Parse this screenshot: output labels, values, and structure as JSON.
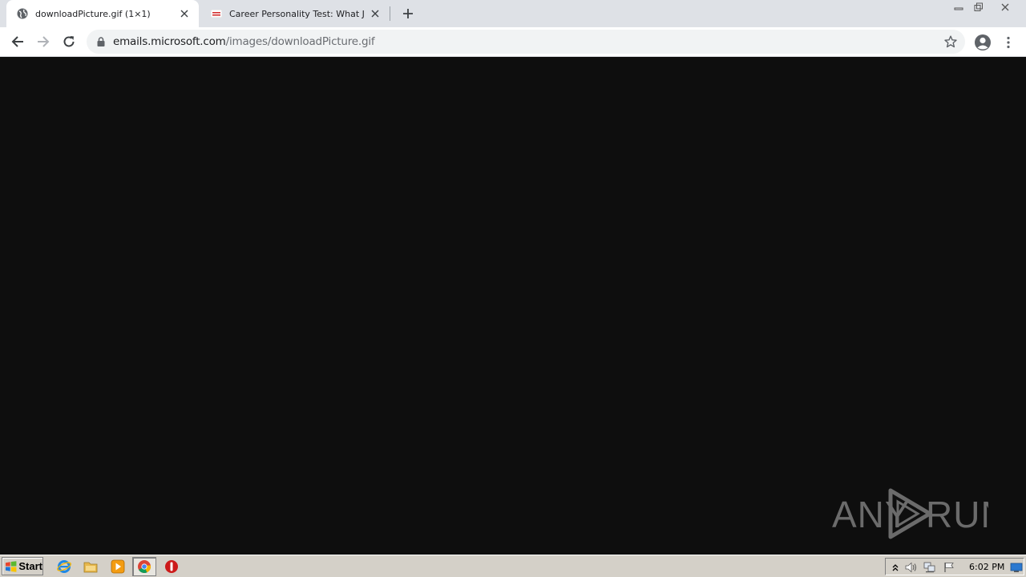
{
  "tabs": [
    {
      "title": "downloadPicture.gif (1×1)",
      "favicon": "globe-icon",
      "active": true
    },
    {
      "title": "Career Personality Test: What Job S",
      "favicon": "site-favicon-icon",
      "active": false
    }
  ],
  "toolbar": {
    "url_host": "emails.microsoft.com",
    "url_path": "/images/downloadPicture.gif"
  },
  "watermark": {
    "text_left": "ANY",
    "text_right": "RUN"
  },
  "taskbar": {
    "start_label": "Start",
    "clock": "6:02 PM",
    "pinned": [
      "internet-explorer-icon",
      "folder-icon",
      "media-player-icon",
      "chrome-icon",
      "antivirus-icon"
    ]
  },
  "colors": {
    "content_bg": "#0e0e0e",
    "tabstrip_bg": "#dee1e6",
    "taskbar_bg": "#d4d0c8"
  }
}
